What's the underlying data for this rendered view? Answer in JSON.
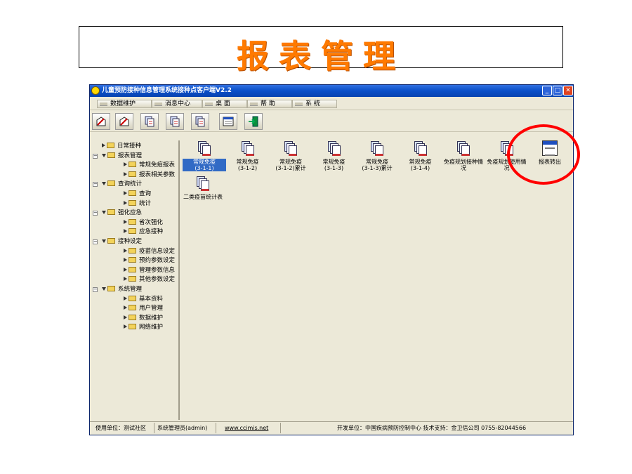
{
  "slide": {
    "title": "报表管理"
  },
  "window": {
    "title": "儿童预防接种信息管理系统接种点客户端V2.2",
    "controls": {
      "minimize": "_",
      "maximize": "□",
      "close": "✕"
    }
  },
  "menubar": {
    "items": [
      "数据维护",
      "消息中心",
      "桌 面",
      "帮 助",
      "系 统"
    ]
  },
  "toolbar": {
    "buttons": [
      "edit-doc-icon",
      "edit-doc-icon",
      "report-doc-icon",
      "report-doc-icon",
      "report-doc-icon",
      "window-icon",
      "exit-door-icon"
    ]
  },
  "tree": {
    "nodes": [
      {
        "label": "日常接种",
        "level": 1,
        "expanded": false
      },
      {
        "label": "报表管理",
        "level": 1,
        "expanded": true
      },
      {
        "label": "常规免疫报表",
        "level": 2,
        "expanded": false
      },
      {
        "label": "报表相关参数",
        "level": 2,
        "expanded": false
      },
      {
        "label": "查询统计",
        "level": 1,
        "expanded": true
      },
      {
        "label": "查询",
        "level": 2,
        "expanded": false
      },
      {
        "label": "统计",
        "level": 2,
        "expanded": false
      },
      {
        "label": "强化应急",
        "level": 1,
        "expanded": true
      },
      {
        "label": "省次强化",
        "level": 2,
        "expanded": false
      },
      {
        "label": "应急接种",
        "level": 2,
        "expanded": false
      },
      {
        "label": "接种设定",
        "level": 1,
        "expanded": true
      },
      {
        "label": "疫苗信息设定",
        "level": 2,
        "expanded": false
      },
      {
        "label": "预约参数设定",
        "level": 2,
        "expanded": false
      },
      {
        "label": "管理参数信息",
        "level": 2,
        "expanded": false
      },
      {
        "label": "其他参数设定",
        "level": 2,
        "expanded": false
      },
      {
        "label": "系统管理",
        "level": 1,
        "expanded": true
      },
      {
        "label": "基本资料",
        "level": 2,
        "expanded": false
      },
      {
        "label": "用户管理",
        "level": 2,
        "expanded": false
      },
      {
        "label": "数据维护",
        "level": 2,
        "expanded": false
      },
      {
        "label": "网络维护",
        "level": 2,
        "expanded": false
      }
    ]
  },
  "reports": [
    {
      "line1": "常规免疫",
      "line2": "(3-1-1)",
      "selected": true
    },
    {
      "line1": "常规免疫",
      "line2": "(3-1-2)"
    },
    {
      "line1": "常规免疫",
      "line2": "(3-1-2)累计"
    },
    {
      "line1": "常规免疫",
      "line2": "(3-1-3)"
    },
    {
      "line1": "常规免疫",
      "line2": "(3-1-3)累计"
    },
    {
      "line1": "常规免疫",
      "line2": "(3-1-4)"
    },
    {
      "line1": "免疫规划接种情",
      "line2": "况"
    },
    {
      "line1": "免疫规划使用情",
      "line2": "况"
    },
    {
      "line1": "报表转出",
      "line2": ""
    },
    {
      "line1": "二类疫苗统计表",
      "line2": ""
    }
  ],
  "statusbar": {
    "unit": "使用单位：测试社区",
    "user": "系统管理员(admin)",
    "website": "www.ccimis.net",
    "developer": "开发单位：中国疾病预防控制中心 技术支持：金卫信公司 0755-82044566"
  },
  "colors": {
    "title_orange": "#ff7a00",
    "highlight_red": "#ff0000",
    "titlebar_blue": "#0a4fc8",
    "window_bg": "#ece9d8"
  }
}
